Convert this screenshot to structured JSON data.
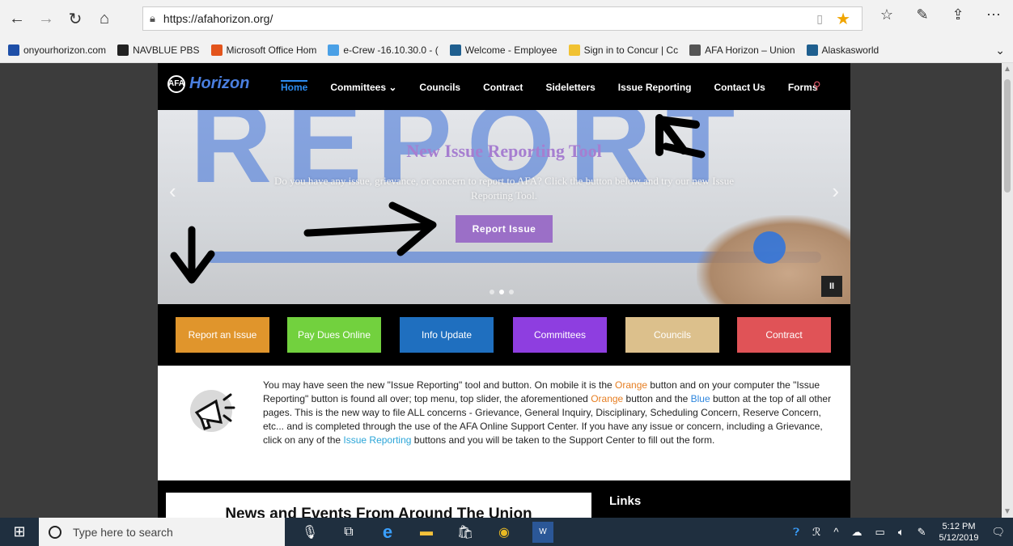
{
  "browser": {
    "url": "https://afahorizon.org/",
    "favorites": [
      {
        "label": "onyourhorizon.com",
        "color": "#1e4fa8"
      },
      {
        "label": "NAVBLUE PBS",
        "color": "#222222"
      },
      {
        "label": "Microsoft Office Hom",
        "color": "#e3541c"
      },
      {
        "label": "e-Crew -16.10.30.0 - (",
        "color": "#4aa0e6"
      },
      {
        "label": "Welcome - Employee",
        "color": "#1f5f8f"
      },
      {
        "label": "Sign in to Concur | Cc",
        "color": "#f1c232"
      },
      {
        "label": "AFA Horizon – Union",
        "color": "#555555"
      },
      {
        "label": "Alaskasworld",
        "color": "#1f5f8f"
      }
    ]
  },
  "site": {
    "logo_text": "Horizon",
    "logo_badge": "AFA",
    "menu": [
      "Home",
      "Committees ⌄",
      "Councils",
      "Contract",
      "Sideletters",
      "Issue Reporting",
      "Contact Us",
      "Forms"
    ],
    "slide": {
      "title": "New Issue Reporting Tool",
      "text": "Do you have any issue, grievance, or concern to report to AFA? Click the button below and try our new Issue Reporting Tool.",
      "button": "Report Issue",
      "bg_word": "REPORT"
    },
    "quick_buttons": [
      {
        "label": "Report an Issue",
        "color": "#e0952c"
      },
      {
        "label": "Pay Dues Online",
        "color": "#72d13e"
      },
      {
        "label": "Info Update",
        "color": "#1f6fbf"
      },
      {
        "label": "Committees",
        "color": "#8e3ee0"
      },
      {
        "label": "Councils",
        "color": "#dcc08c"
      },
      {
        "label": "Contract",
        "color": "#e05357"
      }
    ],
    "announcement": {
      "p1": "You may have seen the new \"Issue Reporting\" tool and button. On mobile it is the ",
      "orange1": "Orange",
      "p2": " button and on your computer the \"Issue Reporting\" button is found all over; top menu, top slider, the aforementioned ",
      "orange2": "Orange",
      "p3": " button and the ",
      "blue": "Blue",
      "p4": " button at the top of all other pages. This is the new way to file ALL concerns - Grievance, General Inquiry, Disciplinary, Scheduling Concern, Reserve Concern, etc... and is completed through the use of the AFA Online Support Center. If you have any issue or concern, including a Grievance, click on any of the ",
      "link": "Issue Reporting",
      "p5": " buttons and you will be taken to the Support Center to fill out the form.",
      "badge_word": "Announcements"
    },
    "news_title": "News and Events From Around The Union",
    "links_title": "Links"
  },
  "taskbar": {
    "search_placeholder": "Type here to search",
    "time": "5:12 PM",
    "date": "5/12/2019"
  }
}
